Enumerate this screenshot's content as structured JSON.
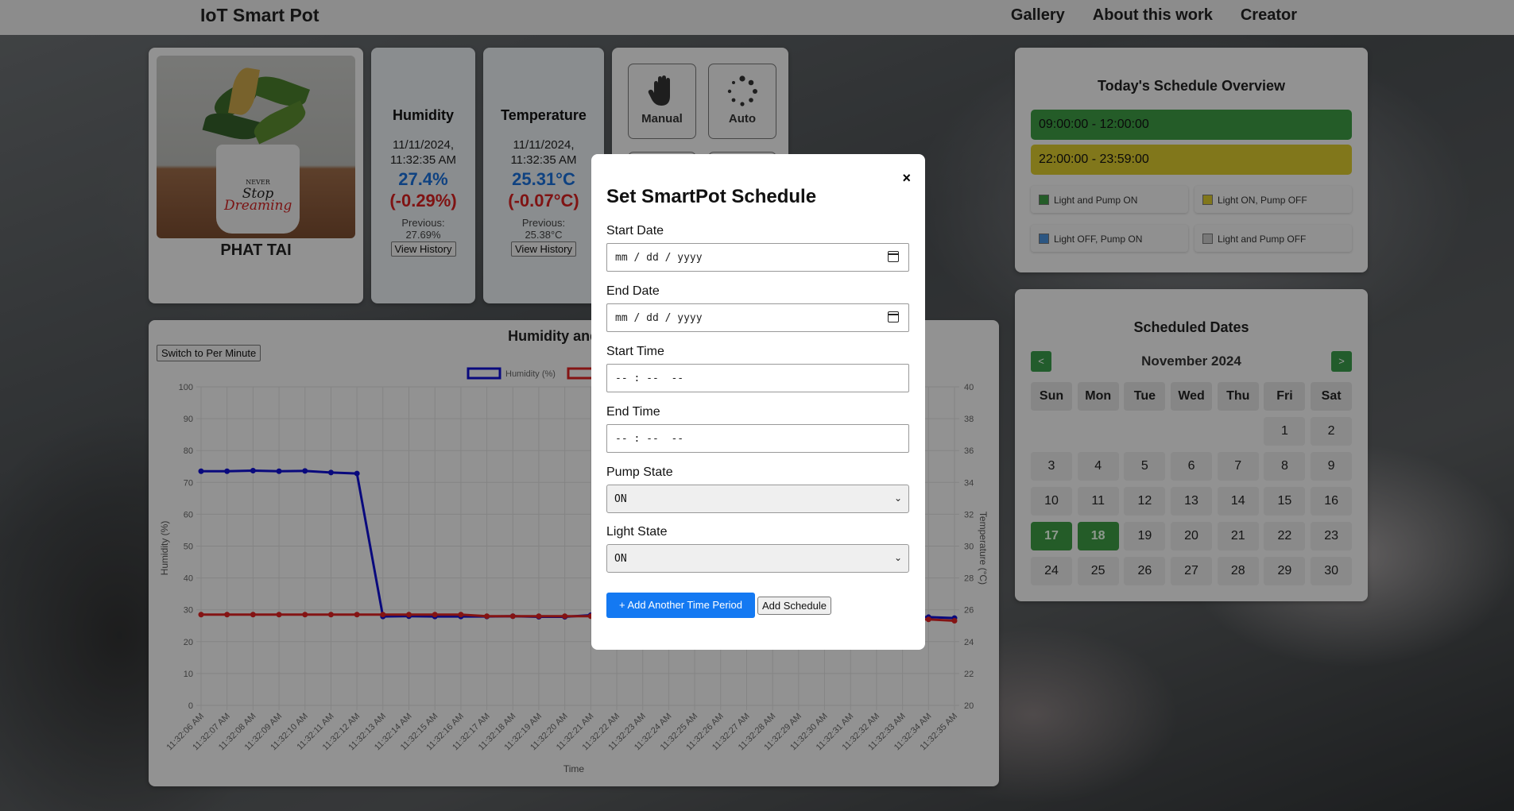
{
  "app": {
    "brand": "IoT Smart Pot",
    "nav": [
      "Gallery",
      "About this work",
      "Creator"
    ]
  },
  "plant": {
    "name": "PHAT TAI",
    "pot_text_1": "NEVER",
    "pot_text_2": "Stop",
    "pot_text_3": "Dreaming"
  },
  "humidity": {
    "title": "Humidity",
    "date": "11/11/2024,",
    "time": "11:32:35 AM",
    "value": "27.4%",
    "delta": "(-0.29%)",
    "prev_label": "Previous:",
    "prev_value": "27.69%",
    "history_btn": "View History"
  },
  "temperature": {
    "title": "Temperature",
    "date": "11/11/2024,",
    "time": "11:32:35 AM",
    "value": "25.31°C",
    "delta": "(-0.07°C)",
    "prev_label": "Previous:",
    "prev_value": "25.38°C",
    "history_btn": "View History"
  },
  "modes": {
    "manual": "Manual",
    "auto": "Auto",
    "manual_icon": "hand-icon",
    "auto_icon": "spinner-icon"
  },
  "chart": {
    "title_visible": "Humidity and Temp",
    "switch_btn": "Switch to Per Minute",
    "legend_humidity": "Humidity (%)",
    "x_title": "Time",
    "y_left_title": "Humidity (%)",
    "y_right_title": "Temperature (°C)",
    "y_left_ticks": [
      "100",
      "90",
      "80",
      "70",
      "60",
      "50",
      "40",
      "30",
      "20",
      "10",
      "0"
    ],
    "y_right_ticks": [
      "40",
      "38",
      "36",
      "34",
      "32",
      "30",
      "28",
      "26",
      "24",
      "22",
      "20"
    ]
  },
  "chart_data": {
    "type": "line",
    "x": [
      "11:32:06 AM",
      "11:32:07 AM",
      "11:32:08 AM",
      "11:32:09 AM",
      "11:32:10 AM",
      "11:32:11 AM",
      "11:32:12 AM",
      "11:32:13 AM",
      "11:32:14 AM",
      "11:32:15 AM",
      "11:32:16 AM",
      "11:32:17 AM",
      "11:32:18 AM",
      "11:32:19 AM",
      "11:32:20 AM",
      "11:32:21 AM",
      "11:32:22 AM",
      "11:32:23 AM",
      "11:32:24 AM",
      "11:32:25 AM",
      "11:32:26 AM",
      "11:32:27 AM",
      "11:32:28 AM",
      "11:32:29 AM",
      "11:32:30 AM",
      "11:32:31 AM",
      "11:32:32 AM",
      "11:32:33 AM",
      "11:32:34 AM",
      "11:32:35 AM"
    ],
    "series": [
      {
        "name": "Humidity (%)",
        "axis": "left",
        "color": "#1010d0",
        "values": [
          73.5,
          73.5,
          73.7,
          73.5,
          73.6,
          73.1,
          72.8,
          27.9,
          28.0,
          27.9,
          27.9,
          27.9,
          28.0,
          27.8,
          27.8,
          28.3,
          28.3,
          28.2,
          28.2,
          28.1,
          28.0,
          28.0,
          27.9,
          27.9,
          27.9,
          27.9,
          27.8,
          27.8,
          27.7,
          27.4
        ]
      },
      {
        "name": "",
        "axis": "right",
        "color": "#dd2222",
        "values": [
          25.7,
          25.7,
          25.7,
          25.7,
          25.7,
          25.7,
          25.7,
          25.7,
          25.7,
          25.7,
          25.7,
          25.6,
          25.6,
          25.6,
          25.6,
          25.6,
          25.6,
          25.6,
          25.6,
          25.6,
          25.5,
          25.5,
          25.5,
          25.5,
          25.5,
          25.5,
          25.4,
          25.4,
          25.4,
          25.31
        ]
      }
    ],
    "ylim_left": [
      0,
      100
    ],
    "ylim_right": [
      20,
      40
    ],
    "xlabel": "Time",
    "ylabel": "Humidity (%)",
    "y2label": "Temperature (°C)",
    "grid": true,
    "legend": "top"
  },
  "schedule": {
    "title": "Today's Schedule Overview",
    "periods": [
      {
        "label": "09:00:00 - 12:00:00",
        "color": "#3c9a44"
      },
      {
        "label": "22:00:00 - 23:59:00",
        "color": "#d8c62e"
      }
    ],
    "legend": [
      {
        "label": "Light and Pump ON",
        "color": "#3c9a44"
      },
      {
        "label": "Light ON, Pump OFF",
        "color": "#d8c62e"
      },
      {
        "label": "Light OFF, Pump ON",
        "color": "#4a90d9"
      },
      {
        "label": "Light and Pump OFF",
        "color": "#c9c9c9"
      }
    ]
  },
  "calendar": {
    "title": "Scheduled Dates",
    "month": "November 2024",
    "prev": "<",
    "next": ">",
    "weekdays": [
      "Sun",
      "Mon",
      "Tue",
      "Wed",
      "Thu",
      "Fri",
      "Sat"
    ],
    "days": [
      "",
      "",
      "",
      "",
      "",
      "1",
      "2",
      "3",
      "4",
      "5",
      "6",
      "7",
      "8",
      "9",
      "10",
      "11",
      "12",
      "13",
      "14",
      "15",
      "16",
      "17",
      "18",
      "19",
      "20",
      "21",
      "22",
      "23",
      "24",
      "25",
      "26",
      "27",
      "28",
      "29",
      "30"
    ],
    "scheduled": [
      "17",
      "18"
    ]
  },
  "modal": {
    "close": "×",
    "title": "Set SmartPot Schedule",
    "start_date_label": "Start Date",
    "start_date_placeholder": "mm / dd / yyyy",
    "end_date_label": "End Date",
    "end_date_placeholder": "mm / dd / yyyy",
    "start_time_label": "Start Time",
    "start_time_placeholder": "-- : --  --",
    "end_time_label": "End Time",
    "end_time_placeholder": "-- : --  --",
    "pump_label": "Pump State",
    "pump_value": "ON",
    "light_label": "Light State",
    "light_value": "ON",
    "add_period_btn": "+ Add Another Time Period",
    "add_schedule_btn": "Add Schedule"
  }
}
